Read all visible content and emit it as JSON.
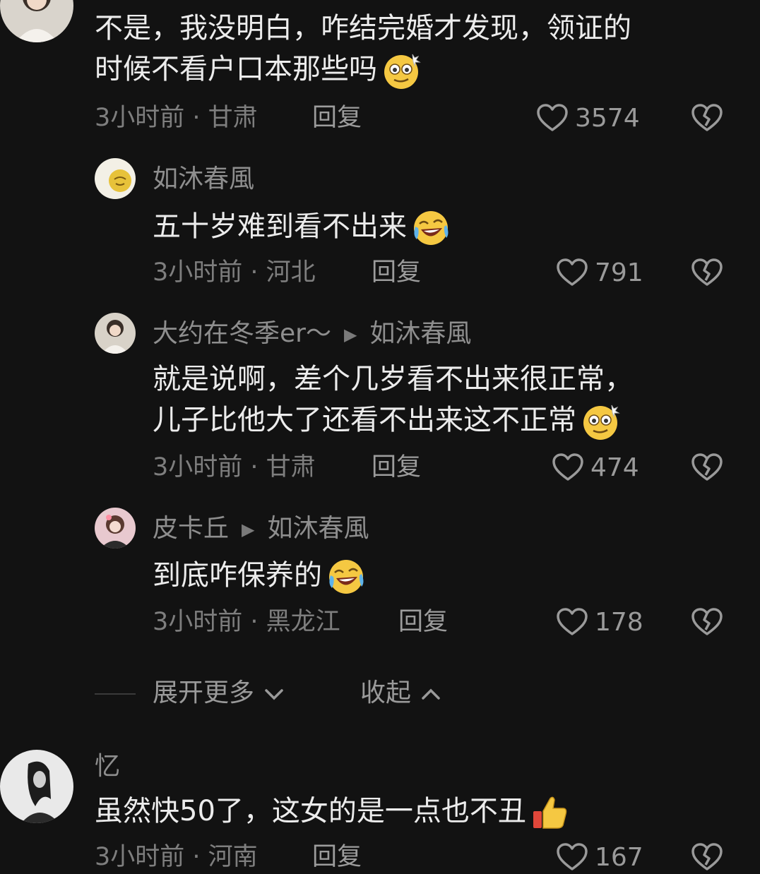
{
  "comments": [
    {
      "text_line1": "不是，我没明白，咋结完婚才发现，领证的",
      "text_line2": "时候不看户口本那些吗",
      "time": "3小时前",
      "location": "甘肃",
      "reply_label": "回复",
      "likes": "3574",
      "emoji": "dizzy-face-emoji"
    },
    {
      "name": "忆",
      "text": "虽然快50了，这女的是一点也不丑",
      "emoji": "thumbs-up-emoji",
      "time": "3小时前",
      "location": "河南",
      "reply_label": "回复",
      "likes": "167"
    }
  ],
  "replies": [
    {
      "name": "如沐春風",
      "text": "五十岁难到看不出来",
      "emoji": "rolling-laughing-emoji",
      "time": "3小时前",
      "location": "河北",
      "reply_label": "回复",
      "likes": "791"
    },
    {
      "name": "大约在冬季er～",
      "reply_to": "如沐春風",
      "text_line1": "就是说啊，差个几岁看不出来很正常，",
      "text_line2": "儿子比他大了还看不出来这不正常",
      "emoji": "dizzy-face-emoji",
      "time": "3小时前",
      "location": "甘肃",
      "reply_label": "回复",
      "likes": "474"
    },
    {
      "name": "皮卡丘",
      "reply_to": "如沐春風",
      "text": "到底咋保养的",
      "emoji": "rolling-laughing-emoji",
      "time": "3小时前",
      "location": "黑龙江",
      "reply_label": "回复",
      "likes": "178"
    }
  ],
  "thread_controls": {
    "expand_label": "展开更多",
    "collapse_label": "收起"
  },
  "colors": {
    "background": "#121212",
    "text": "#ececec",
    "muted": "#8e8e8e"
  }
}
